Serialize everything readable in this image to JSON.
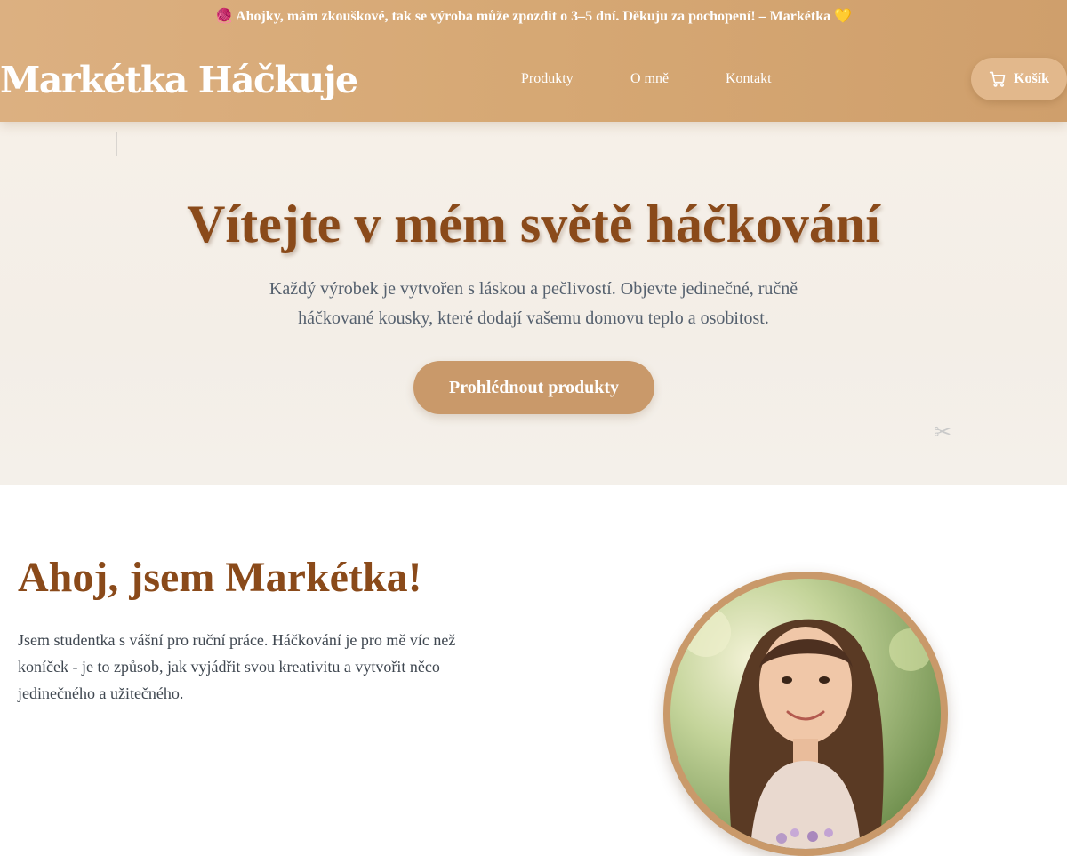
{
  "announcement": "🧶 Ahojky, mám zkouškové, tak se výroba může zpozdit o 3–5 dní. Děkuju za pochopení! – Markétka 💛",
  "logo": "Markétka Háčkuje",
  "nav": {
    "items": [
      {
        "label": "Produkty"
      },
      {
        "label": "O mně"
      },
      {
        "label": "Kontakt"
      }
    ],
    "cart_label": "Košík",
    "cart_icon": "cart-icon"
  },
  "hero": {
    "title": "Vítejte v mém světě háčkování",
    "text": "Každý výrobek je vytvořen s láskou a pečlivostí. Objevte jedinečné, ručně háčkované kousky, které dodají vašemu domovu teplo a osobitost.",
    "cta": "Prohlédnout produkty",
    "deco_icons": [
      "placeholder-glyph-icon",
      "scissors-icon"
    ]
  },
  "about": {
    "title": "Ahoj, jsem Markétka!",
    "text": "Jsem studentka s vášní pro ruční práce. Háčkování je pro mě víc než koníček - je to způsob, jak vyjádřit svou kreativitu a vytvořit něco jedinečného a užitečného."
  },
  "colors": {
    "header": "#d6a874",
    "accent": "#c9996a",
    "title_brown": "#8a4a1a",
    "text_gray": "#55606e"
  }
}
